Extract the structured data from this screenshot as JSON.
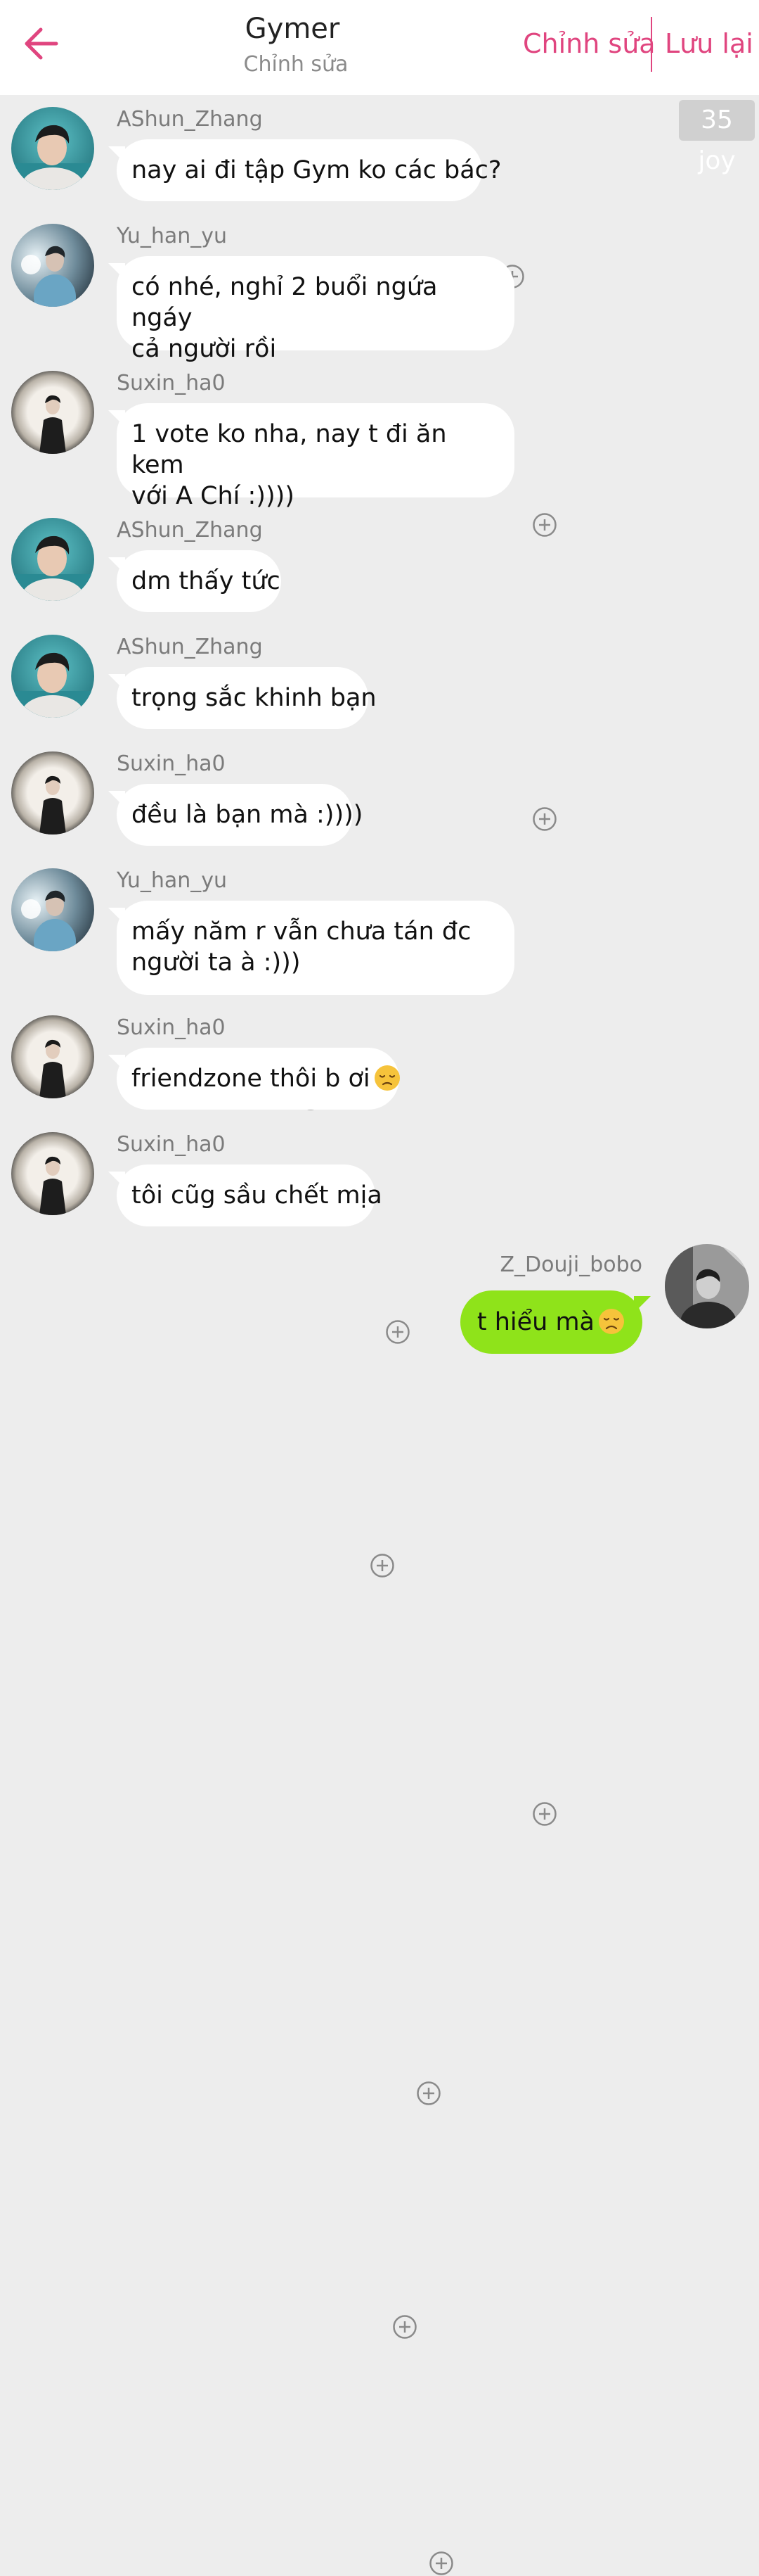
{
  "header": {
    "title": "Gymer",
    "subtitle": "Chỉnh sửa",
    "edit_label": "Chỉnh sửa",
    "save_label": "Lưu lại",
    "accent_color": "#e0457f"
  },
  "badge": {
    "text": "35 joy"
  },
  "messages": [
    {
      "user": "AShun_Zhang",
      "text": "nay ai đi tập Gym ko các bác?"
    },
    {
      "user": "Yu_han_yu",
      "line1": "có nhé, nghỉ 2 buổi ngứa ngáy",
      "line2": "cả người rồi"
    },
    {
      "user": "Suxin_ha0",
      "line1": "1 vote ko nha, nay t đi ăn kem",
      "line2": "với A Chí :))))"
    },
    {
      "user": "AShun_Zhang",
      "text": "dm thấy tức"
    },
    {
      "user": "AShun_Zhang",
      "text": "trọng sắc khinh bạn"
    },
    {
      "user": "Suxin_ha0",
      "text": "đều là bạn mà :))))"
    },
    {
      "user": "Yu_han_yu",
      "line1": "mấy năm r vẫn chưa tán đc",
      "line2": "người ta à :)))"
    },
    {
      "user": "Suxin_ha0",
      "text": "friendzone thôi b ơi",
      "emoji": "pensive-face"
    },
    {
      "user": "Suxin_ha0",
      "text": "tôi cũg sầu chết mịa"
    }
  ],
  "own_message": {
    "user": "Z_Douji_bobo",
    "text": "t hiểu mà",
    "emoji": "disappointed-face",
    "bubble_color": "#8fe31a"
  },
  "icons": {
    "back": "arrow-left-icon",
    "add": "plus-circle-icon"
  }
}
